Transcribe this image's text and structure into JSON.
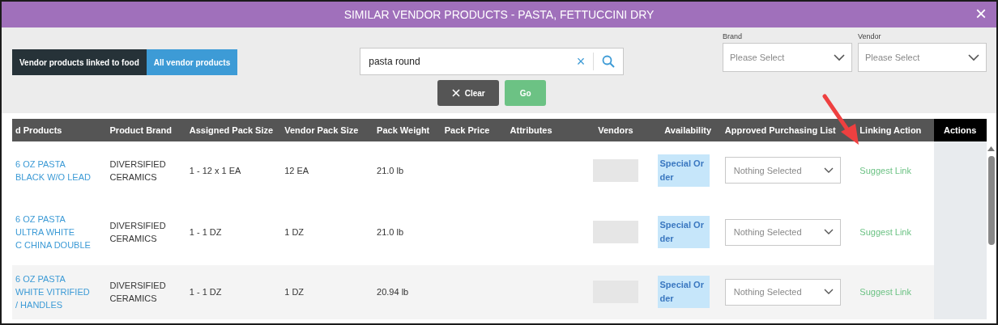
{
  "window": {
    "title": "SIMILAR VENDOR PRODUCTS - PASTA, FETTUCCINI DRY",
    "close": "×"
  },
  "tabs": [
    {
      "label": "Vendor products linked to food",
      "selected": false
    },
    {
      "label": "All vendor products",
      "selected": true
    }
  ],
  "search": {
    "value": "pasta round",
    "clear": "×"
  },
  "buttons": {
    "clear": "Clear",
    "go": "Go"
  },
  "filters": [
    {
      "label": "Brand",
      "placeholder": "Please Select"
    },
    {
      "label": "Vendor",
      "placeholder": "Please Select"
    }
  ],
  "table": {
    "columns": [
      "d Products",
      "Product Brand",
      "Assigned Pack Size",
      "Vendor Pack Size",
      "Pack Weight",
      "Pack Price",
      "Attributes",
      "Vendors",
      "Availability",
      "Approved Purchasing List",
      "Linking Action",
      "Actions"
    ],
    "rows": [
      {
        "product": [
          "6 OZ PASTA",
          "BLACK W/O LEAD"
        ],
        "brand": "DIVERSIFIED CERAMICS",
        "assigned": "1 - 12 x 1 EA",
        "vendor_pack": "12 EA",
        "weight": "21.0 lb",
        "availability": "Special Order",
        "purchasing_list": "Nothing Selected",
        "linking": "Suggest Link"
      },
      {
        "product": [
          "6 OZ PASTA",
          "ULTRA WHITE",
          "C CHINA DOUBLE"
        ],
        "brand": "DIVERSIFIED CERAMICS",
        "assigned": "1 - 1 DZ",
        "vendor_pack": "1 DZ",
        "weight": "21.0 lb",
        "availability": "Special Order",
        "purchasing_list": "Nothing Selected",
        "linking": "Suggest Link"
      },
      {
        "product": [
          "6 OZ PASTA",
          "WHITE VITRIFIED",
          "/ HANDLES"
        ],
        "brand": "DIVERSIFIED CERAMICS",
        "assigned": "1 - 1 DZ",
        "vendor_pack": "1 DZ",
        "weight": "20.94 lb",
        "availability": "Special Order",
        "purchasing_list": "Nothing Selected",
        "linking": "Suggest Link"
      }
    ]
  }
}
